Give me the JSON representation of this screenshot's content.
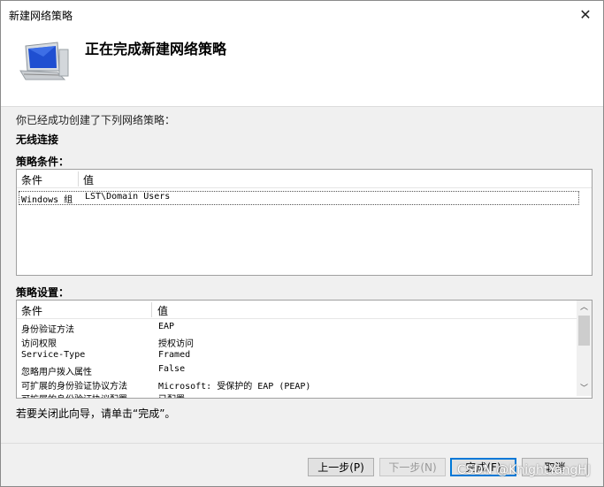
{
  "window": {
    "title": "新建网络策略"
  },
  "header": {
    "title": "正在完成新建网络策略"
  },
  "intro": "你已经成功创建了下列网络策略：",
  "policy_name": "无线连接",
  "conditions": {
    "label": "策略条件：",
    "columns": [
      "条件",
      "值"
    ],
    "rows": [
      {
        "cond": "Windows 组",
        "value": "LST\\Domain Users"
      }
    ]
  },
  "settings": {
    "label": "策略设置：",
    "columns": [
      "条件",
      "值"
    ],
    "rows": [
      {
        "cond": "身份验证方法",
        "value": "EAP"
      },
      {
        "cond": "访问权限",
        "value": "授权访问"
      },
      {
        "cond": "Service-Type",
        "value": "Framed"
      },
      {
        "cond": "忽略用户拨入属性",
        "value": "False"
      },
      {
        "cond": "可扩展的身份验证协议方法",
        "value": "Microsoft: 受保护的 EAP (PEAP)"
      },
      {
        "cond": "可扩展的身份验证协议配置",
        "value": "已配置"
      }
    ]
  },
  "finish_hint": "若要关闭此向导，请单击“完成”。",
  "buttons": {
    "prev": "上一步(P)",
    "next": "下一步(N)",
    "finish": "完成(F)",
    "cancel": "取消"
  },
  "watermark": "CSDN @KnightYangHJ"
}
